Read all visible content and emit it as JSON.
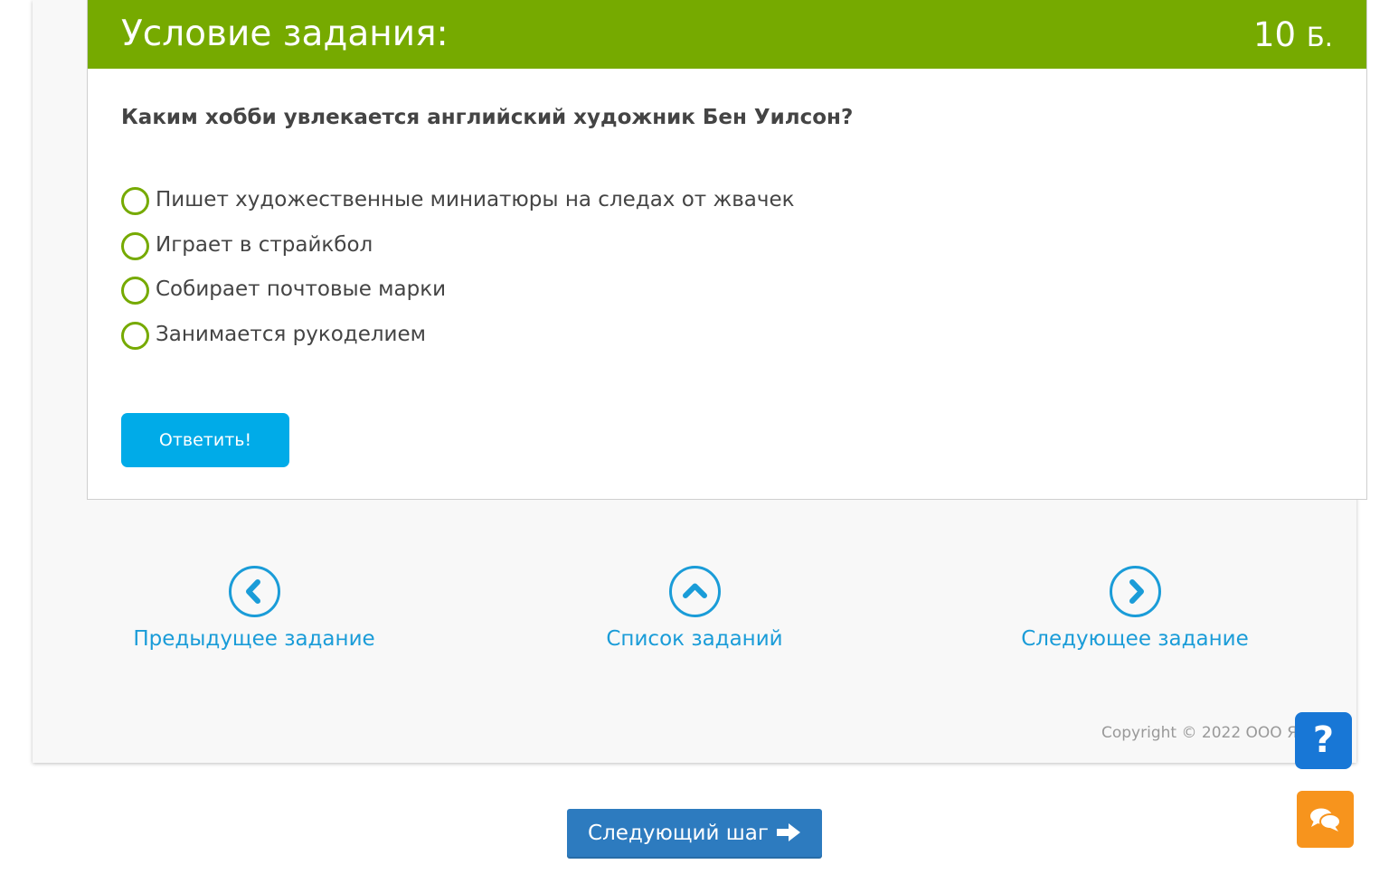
{
  "task": {
    "title": "Условие задания:",
    "points_value": "10",
    "points_unit": "Б.",
    "question": "Каким хобби увлекается английский художник Бен Уилсон?",
    "options": [
      {
        "label": "Пишет художественные миниатюры на следах от жвачек",
        "selected": false
      },
      {
        "label": "Играет в страйкбол",
        "selected": false
      },
      {
        "label": "Собирает почтовые марки",
        "selected": false
      },
      {
        "label": "Занимается рукоделием",
        "selected": false
      }
    ],
    "answer_button": "Ответить!"
  },
  "navigation": {
    "previous": {
      "label": "Предыдущее задание",
      "icon": "chevron-left-icon"
    },
    "list": {
      "label": "Список заданий",
      "icon": "chevron-up-icon"
    },
    "next": {
      "label": "Следующее задание",
      "icon": "chevron-right-icon"
    }
  },
  "footer": {
    "copyright": "Copyright © 2022 ООО ЯК"
  },
  "floating": {
    "help_label": "?",
    "chat_icon": "chat-bubbles-icon"
  },
  "next_step_button": "Следующий шаг",
  "colors": {
    "header_green": "#76aa00",
    "accent_blue": "#00abe8",
    "link_blue": "#1a9cd8",
    "help_blue": "#1877d6",
    "chat_orange": "#f7941d",
    "next_step_blue": "#2d7bbf"
  }
}
